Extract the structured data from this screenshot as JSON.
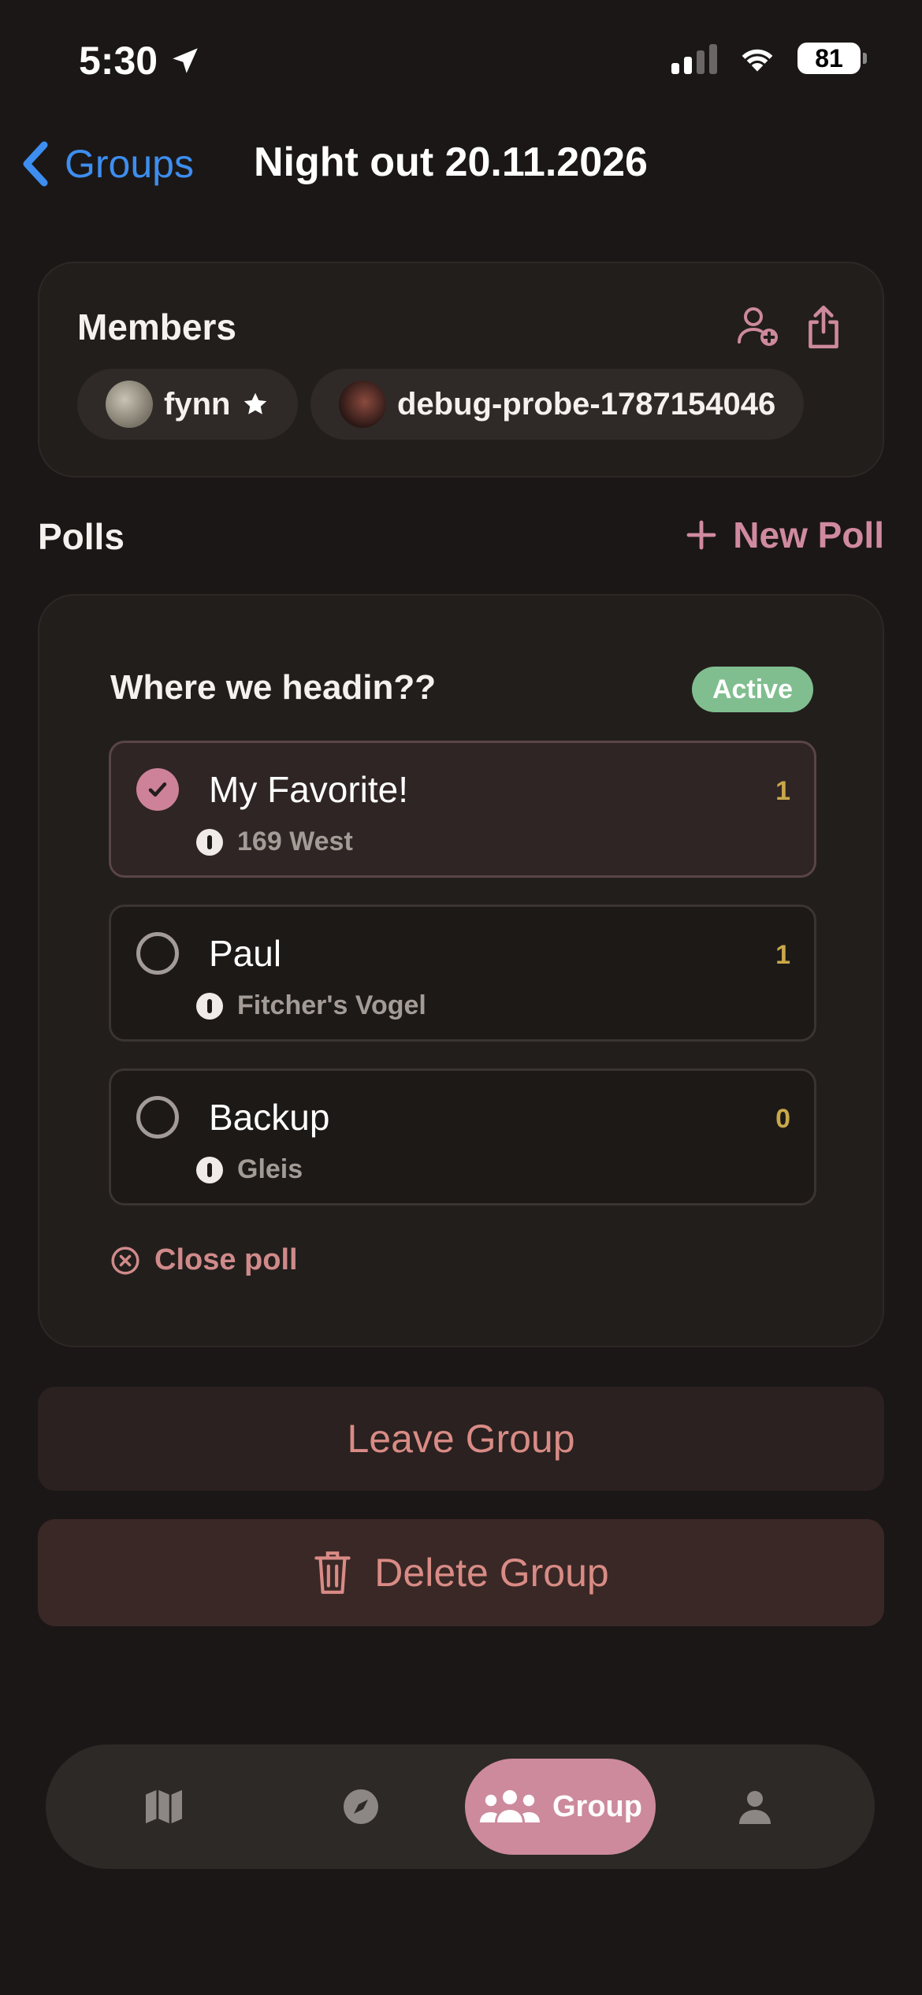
{
  "status_bar": {
    "time": "5:30",
    "battery": "81"
  },
  "nav": {
    "back_label": "Groups",
    "title": "Night out 20.11.2026"
  },
  "members": {
    "title": "Members",
    "list": [
      {
        "name": "fynn",
        "is_owner": true
      },
      {
        "name": "debug-probe-1787154046",
        "is_owner": false
      }
    ]
  },
  "polls": {
    "title": "Polls",
    "new_poll_label": "New Poll",
    "poll": {
      "question": "Where we headin??",
      "status": "Active",
      "options": [
        {
          "name": "My Favorite!",
          "location": "169 West",
          "votes": "1",
          "selected": true
        },
        {
          "name": "Paul",
          "location": "Fitcher's Vogel",
          "votes": "1",
          "selected": false
        },
        {
          "name": "Backup",
          "location": "Gleis",
          "votes": "0",
          "selected": false
        }
      ],
      "close_label": "Close poll"
    }
  },
  "actions": {
    "leave_label": "Leave Group",
    "delete_label": "Delete Group"
  },
  "tabbar": {
    "active_label": "Group",
    "tabs": [
      "map-icon",
      "compass-icon",
      "group-icon",
      "person-icon"
    ]
  },
  "colors": {
    "accent": "#cd8a9c",
    "link": "#3d8ef0",
    "active_badge": "#80be8f",
    "danger_text": "#d98b85"
  }
}
